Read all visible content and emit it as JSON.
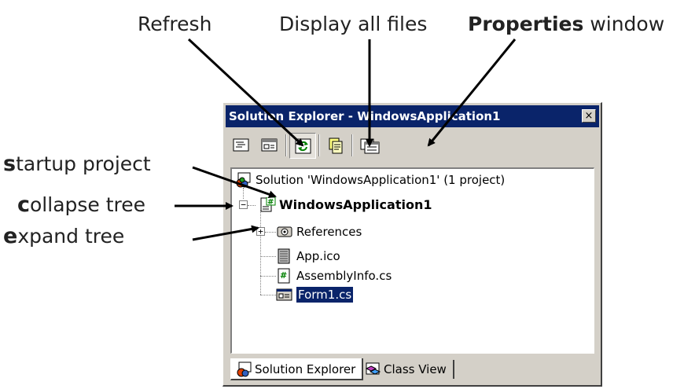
{
  "callouts": {
    "refresh": "Refresh",
    "display_all_files": "Display all files",
    "properties_bold": "Properties",
    "properties_rest": " window",
    "startup_cap": "s",
    "startup_rest": "tartup project",
    "collapse_cap": "c",
    "collapse_rest": "ollapse tree",
    "expand_cap": "e",
    "expand_rest": "xpand tree"
  },
  "window": {
    "title": "Solution Explorer - WindowsApplication1",
    "close_glyph": "×"
  },
  "toolbar": {
    "buttons": [
      "view-code",
      "view-designer",
      "refresh",
      "show-all-files",
      "properties"
    ]
  },
  "tree": {
    "solution": "Solution 'WindowsApplication1' (1 project)",
    "project": "WindowsApplication1",
    "items": [
      {
        "label": "References",
        "icon": "references-icon"
      },
      {
        "label": "App.ico",
        "icon": "ico-file-icon"
      },
      {
        "label": "AssemblyInfo.cs",
        "icon": "cs-file-icon"
      },
      {
        "label": "Form1.cs",
        "icon": "form-file-icon"
      }
    ],
    "collapse_glyph": "−",
    "expand_glyph": "+"
  },
  "tabs": {
    "solution_explorer": "Solution Explorer",
    "class_view": "Class View"
  },
  "colors": {
    "titlebar": "#0a246a",
    "chrome": "#d4d0c8",
    "selection": "#0a246a"
  }
}
